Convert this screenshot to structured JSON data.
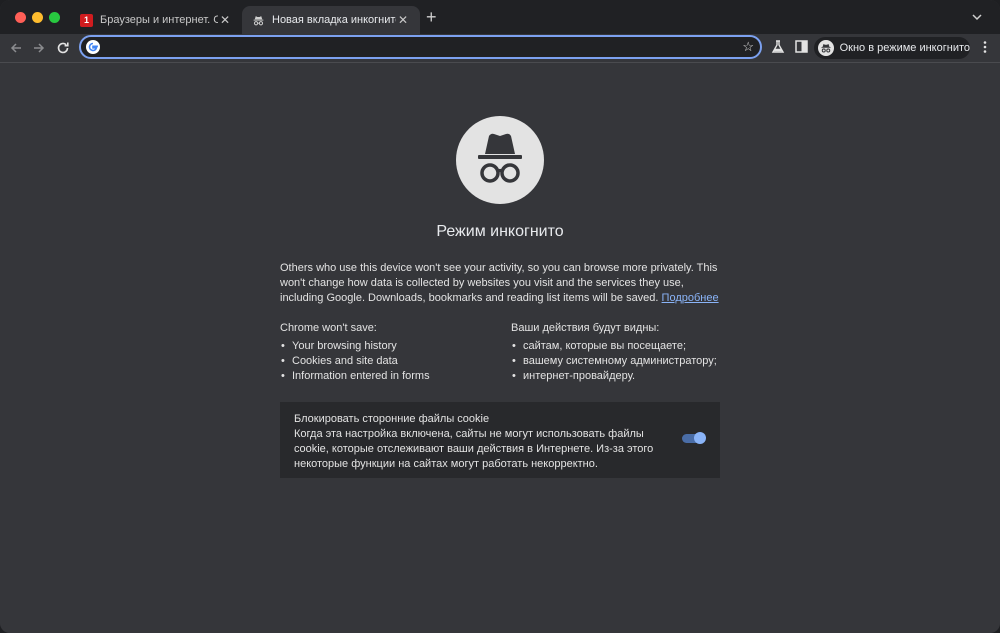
{
  "tabs": [
    {
      "label": "Браузеры и интернет. Скача",
      "favicon": "brand-red-icon",
      "active": false
    },
    {
      "label": "Новая вкладка инкогнито",
      "favicon": "incognito-icon",
      "active": true
    }
  ],
  "toolbar": {
    "address_value": "",
    "incognito_chip_label": "Окно в режиме инкогнито"
  },
  "page": {
    "title": "Режим инкогнито",
    "intro_text": "Others who use this device won't see your activity, so you can browse more privately. This won't change how data is collected by websites you visit and the services they use, including Google. Downloads, bookmarks and reading list items will be saved.",
    "learn_more": "Подробнее",
    "left_heading": "Chrome won't save:",
    "left_items": [
      "Your browsing history",
      "Cookies and site data",
      "Information entered in forms"
    ],
    "right_heading": "Ваши действия будут видны:",
    "right_items": [
      "сайтам, которые вы посещаете;",
      "вашему системному администратору;",
      "интернет-провайдеру."
    ],
    "cookie_title": "Блокировать сторонние файлы cookie",
    "cookie_desc": "Когда эта настройка включена, сайты не могут использовать файлы cookie, которые отслеживают ваши действия в Интернете. Из-за этого некоторые функции на сайтах могут работать некорректно.",
    "cookie_toggle_on": true
  },
  "colors": {
    "accent": "#8ab4f8",
    "background": "#35363a"
  }
}
